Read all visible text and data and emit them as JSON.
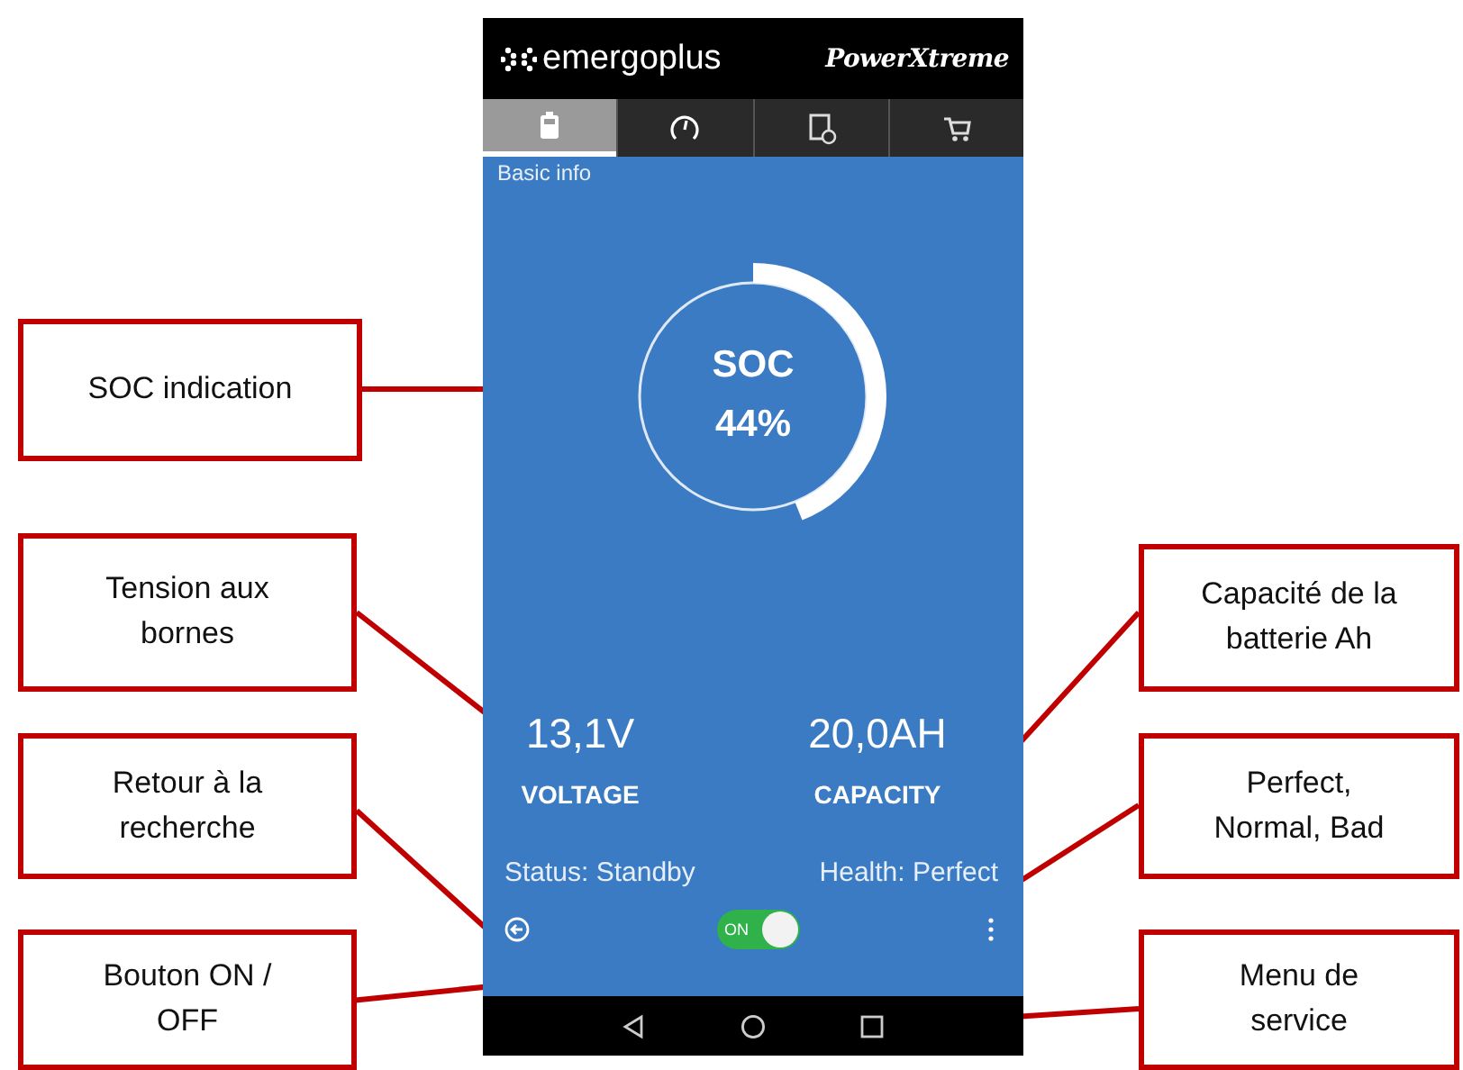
{
  "header": {
    "brand": "emergoplus",
    "product": "PowerXtreme"
  },
  "tabs": [
    {
      "selected": true
    },
    {
      "selected": false
    },
    {
      "selected": false
    },
    {
      "selected": false
    }
  ],
  "section_title": "Basic info",
  "soc": {
    "label": "SOC",
    "value": "44%"
  },
  "readings": [
    {
      "value": "13,1V",
      "label": "VOLTAGE"
    },
    {
      "value": "20,0AH",
      "label": "CAPACITY"
    }
  ],
  "status": "Status: Standby",
  "health": "Health: Perfect",
  "power_switch": {
    "label": "ON",
    "on": true
  },
  "callouts": [
    {
      "text": "SOC indication"
    },
    {
      "text": "Tension aux\nbornes"
    },
    {
      "text": "Retour à la\nrecherche"
    },
    {
      "text": "Bouton ON /\nOFF"
    },
    {
      "text": "Capacité de la\nbatterie Ah"
    },
    {
      "text": "Perfect,\nNormal, Bad"
    },
    {
      "text": "Menu de\nservice"
    }
  ]
}
